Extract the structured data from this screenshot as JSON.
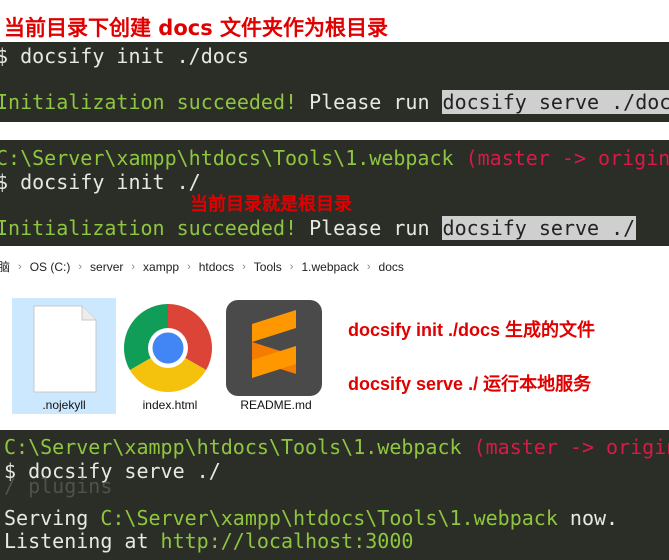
{
  "captions": {
    "top": "当前目录下创建 docs 文件夹作为根目录",
    "middle": "当前目录就是根目录"
  },
  "terminal1": {
    "cmd": "$ docsify init ./docs",
    "msg_ok": "Initialization succeeded!",
    "msg_please": " Please run ",
    "msg_cmd": "docsify serve ./docs"
  },
  "terminal2": {
    "path": "C:\\Server\\xampp\\htdocs\\Tools\\1.webpack",
    "branch": " (master -> origin)",
    "cmd": "$ docsify init ./",
    "msg_ok": "Initialization succeeded!",
    "msg_please": " Please run ",
    "msg_cmd": "docsify serve ./"
  },
  "explorer": {
    "breadcrumb": [
      "脑",
      "OS (C:)",
      "server",
      "xampp",
      "htdocs",
      "Tools",
      "1.webpack",
      "docs"
    ],
    "files": [
      {
        "name": ".nojekyll",
        "icon": "blank-file-icon"
      },
      {
        "name": "index.html",
        "icon": "chrome-icon"
      },
      {
        "name": "README.md",
        "icon": "sublime-text-icon"
      }
    ],
    "notes": [
      "docsify init ./docs 生成的文件",
      "docsify serve ./ 运行本地服务"
    ]
  },
  "terminal3": {
    "path": "C:\\Server\\xampp\\htdocs\\Tools\\1.webpack",
    "branch": " (master -> origin)",
    "cmd": "$ docsify serve ./",
    "ghost": "/ plugins",
    "serving_label": "Serving ",
    "serving_path": "C:\\Server\\xampp\\htdocs\\Tools\\1.webpack",
    "serving_suffix": " now.",
    "listening_label": "Listening at ",
    "listening_url": "http://localhost:3000"
  },
  "colors": {
    "terminal_bg": "#2b2d27",
    "green": "#8ec63f",
    "red": "#d81b46",
    "caption_red": "#e00000"
  }
}
